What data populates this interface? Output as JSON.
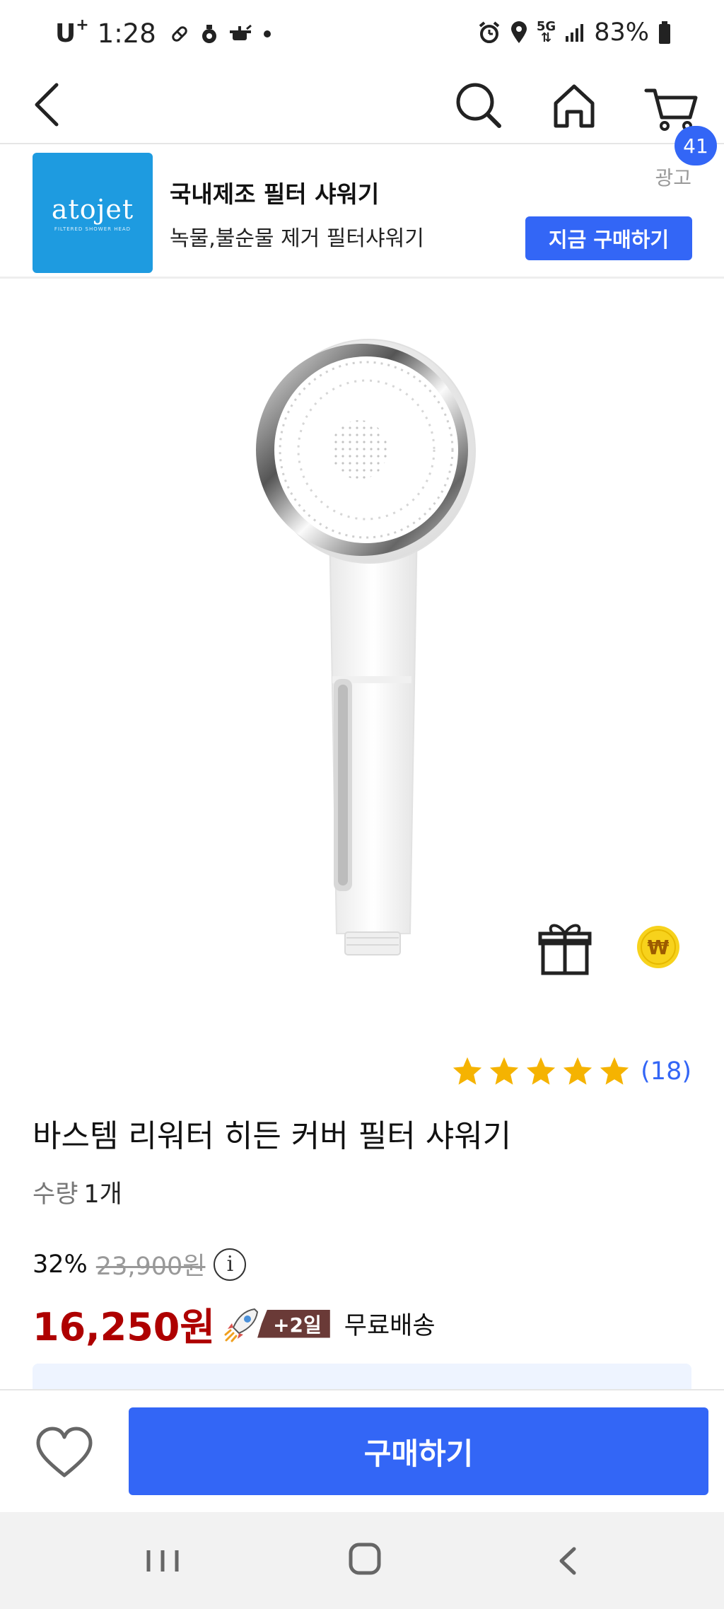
{
  "status_bar": {
    "carrier": "U",
    "carrier_sup": "+",
    "time": "1:28",
    "network": "5G",
    "battery": "83%",
    "icons": [
      "pill-icon",
      "drop-icon",
      "pot-icon",
      "dot-icon",
      "alarm-icon",
      "location-icon",
      "network-5g-icon",
      "signal-icon",
      "battery-icon"
    ]
  },
  "nav": {
    "cart_count": "41",
    "icons": [
      "back-icon",
      "search-icon",
      "home-icon",
      "cart-icon"
    ]
  },
  "ad": {
    "logo_text": "atojet",
    "logo_subtext": "FILTERED SHOWER HEAD",
    "title": "국내제조 필터 샤워기",
    "description": "녹물,불순물 제거 필터샤워기",
    "label": "광고",
    "cta": "지금 구매하기"
  },
  "product": {
    "rating_stars": 5,
    "review_count": "(18)",
    "name": "바스템 리워터 히든 커버 필터 샤워기",
    "quantity_label": "수량",
    "quantity_value": "1개",
    "discount": "32%",
    "original_price": "23,900원",
    "info_glyph": "i",
    "sale_price": "16,250원",
    "delivery_badge": "+2일",
    "shipping": "무료배송"
  },
  "bottom": {
    "buy_label": "구매하기"
  },
  "colors": {
    "accent": "#3366f6",
    "price": "#ae0000",
    "star": "#f5b301",
    "badge": "#6a3a37"
  }
}
